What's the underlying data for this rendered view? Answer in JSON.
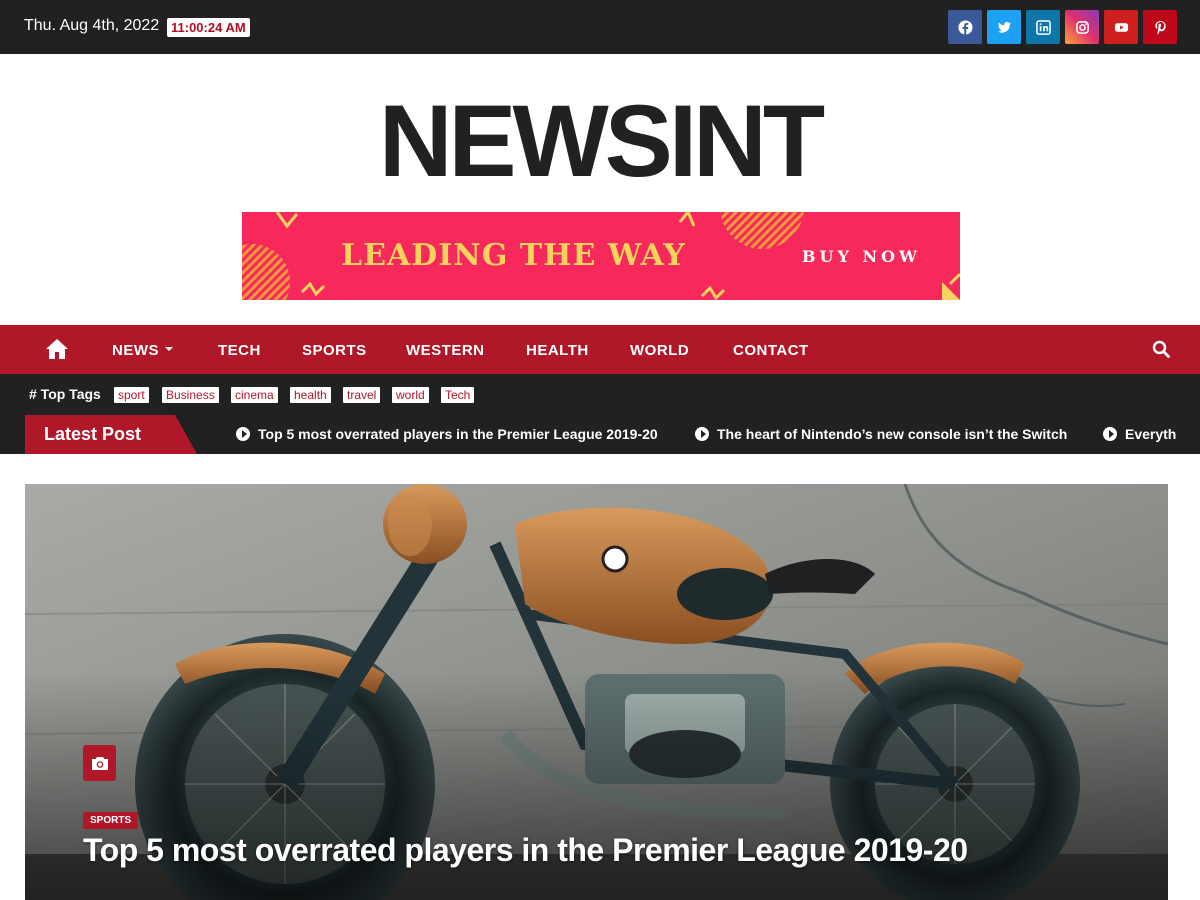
{
  "topbar": {
    "date": "Thu. Aug 4th, 2022",
    "time": "11:00:24 AM",
    "social": [
      {
        "name": "facebook-icon",
        "color": "#3b5998"
      },
      {
        "name": "twitter-icon",
        "color": "#1da1f2"
      },
      {
        "name": "linkedin-icon",
        "color": "#0e76a8"
      },
      {
        "name": "instagram-icon",
        "color": "#c13584"
      },
      {
        "name": "youtube-icon",
        "color": "#cd201f"
      },
      {
        "name": "pinterest-icon",
        "color": "#bd081c"
      }
    ]
  },
  "header": {
    "logo": "NEWSINT",
    "banner_headline": "LEADING THE WAY",
    "banner_cta": "BUY NOW"
  },
  "nav": {
    "items": [
      "NEWS",
      "TECH",
      "SPORTS",
      "WESTERN",
      "HEALTH",
      "WORLD",
      "CONTACT"
    ]
  },
  "tags": {
    "title": "# Top Tags",
    "items": [
      "sport",
      "Business",
      "cinema",
      "health",
      "travel",
      "world",
      "Tech"
    ]
  },
  "latest": {
    "label": "Latest Post",
    "posts": [
      "Top 5 most overrated players in the Premier League 2019-20",
      "The heart of Nintendo’s new console isn’t the Switch",
      "Everyth"
    ]
  },
  "hero": {
    "category": "SPORTS",
    "title": "Top 5 most overrated players in the Premier League 2019-20"
  },
  "colors": {
    "accent": "#b01729",
    "dark": "#212121",
    "banner_bg": "#f7285b",
    "banner_text": "#f6d35c"
  }
}
